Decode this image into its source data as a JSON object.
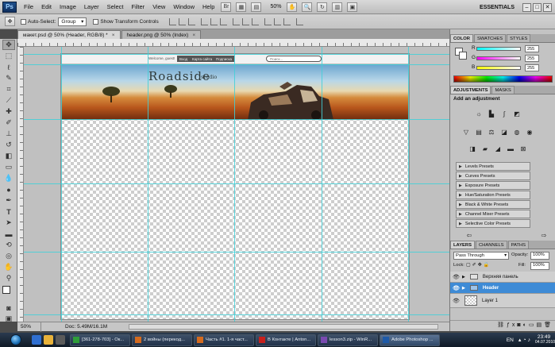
{
  "app": {
    "logo_text": "Ps",
    "menus": [
      "File",
      "Edit",
      "Image",
      "Layer",
      "Select",
      "Filter",
      "View",
      "Window",
      "Help"
    ],
    "zoom": "50%",
    "workspace": "ESSENTIALS"
  },
  "options_bar": {
    "auto_select_label": "Auto-Select:",
    "auto_select_value": "Group",
    "transform_label": "Show Transform Controls"
  },
  "doc_tabs": [
    {
      "label": "макет.psd @ 50% (Header, RGB/8) *",
      "active": true
    },
    {
      "label": "header.png @ 50% (Index)",
      "active": false
    }
  ],
  "site": {
    "welcome": "Welcome, guest!",
    "nav": [
      "Вход",
      "Карта сайта",
      "Подписка"
    ],
    "search_placeholder": "Поиск...",
    "brand": "Roadside",
    "brand_sub": "studio"
  },
  "status": {
    "zoom": "50%",
    "doc": "Doc: 5.49M/16.1M"
  },
  "color_panel": {
    "tabs": [
      "COLOR",
      "SWATCHES",
      "STYLES"
    ],
    "r_label": "R",
    "g_label": "G",
    "b_label": "B",
    "r": "255",
    "g": "255",
    "b": "255"
  },
  "adjustments_panel": {
    "tabs": [
      "ADJUSTMENTS",
      "MASKS"
    ],
    "heading": "Add an adjustment",
    "presets": [
      "Levels Presets",
      "Curves Presets",
      "Exposure Presets",
      "Hue/Saturation Presets",
      "Black & White Presets",
      "Channel Mixer Presets",
      "Selective Color Presets"
    ]
  },
  "layers_panel": {
    "tabs": [
      "LAYERS",
      "CHANNELS",
      "PATHS"
    ],
    "blend_mode": "Pass Through",
    "opacity_label": "Opacity:",
    "opacity": "100%",
    "lock_label": "Lock:",
    "fill_label": "Fill:",
    "fill": "100%",
    "layers": [
      {
        "name": "Верхняя панель",
        "type": "group",
        "selected": false
      },
      {
        "name": "Header",
        "type": "group",
        "selected": true
      },
      {
        "name": "Layer 1",
        "type": "layer",
        "selected": false
      }
    ]
  },
  "taskbar": {
    "tasks": [
      {
        "label": "[361-278-703] - Ок...",
        "color": "#2f9d3a"
      },
      {
        "label": "2 войны (перекод...",
        "color": "#d46b1f"
      },
      {
        "label": "Часть #1. 1-я част...",
        "color": "#d46b1f"
      },
      {
        "label": "В Контакте | Anton...",
        "color": "#c8201c"
      },
      {
        "label": "lesson3.zip - WinR...",
        "color": "#7a4ab0"
      },
      {
        "label": "Adobe Photoshop ...",
        "color": "#1e5aa8"
      }
    ],
    "lang": "EN",
    "time": "23:49",
    "date": "04.07.2010"
  }
}
